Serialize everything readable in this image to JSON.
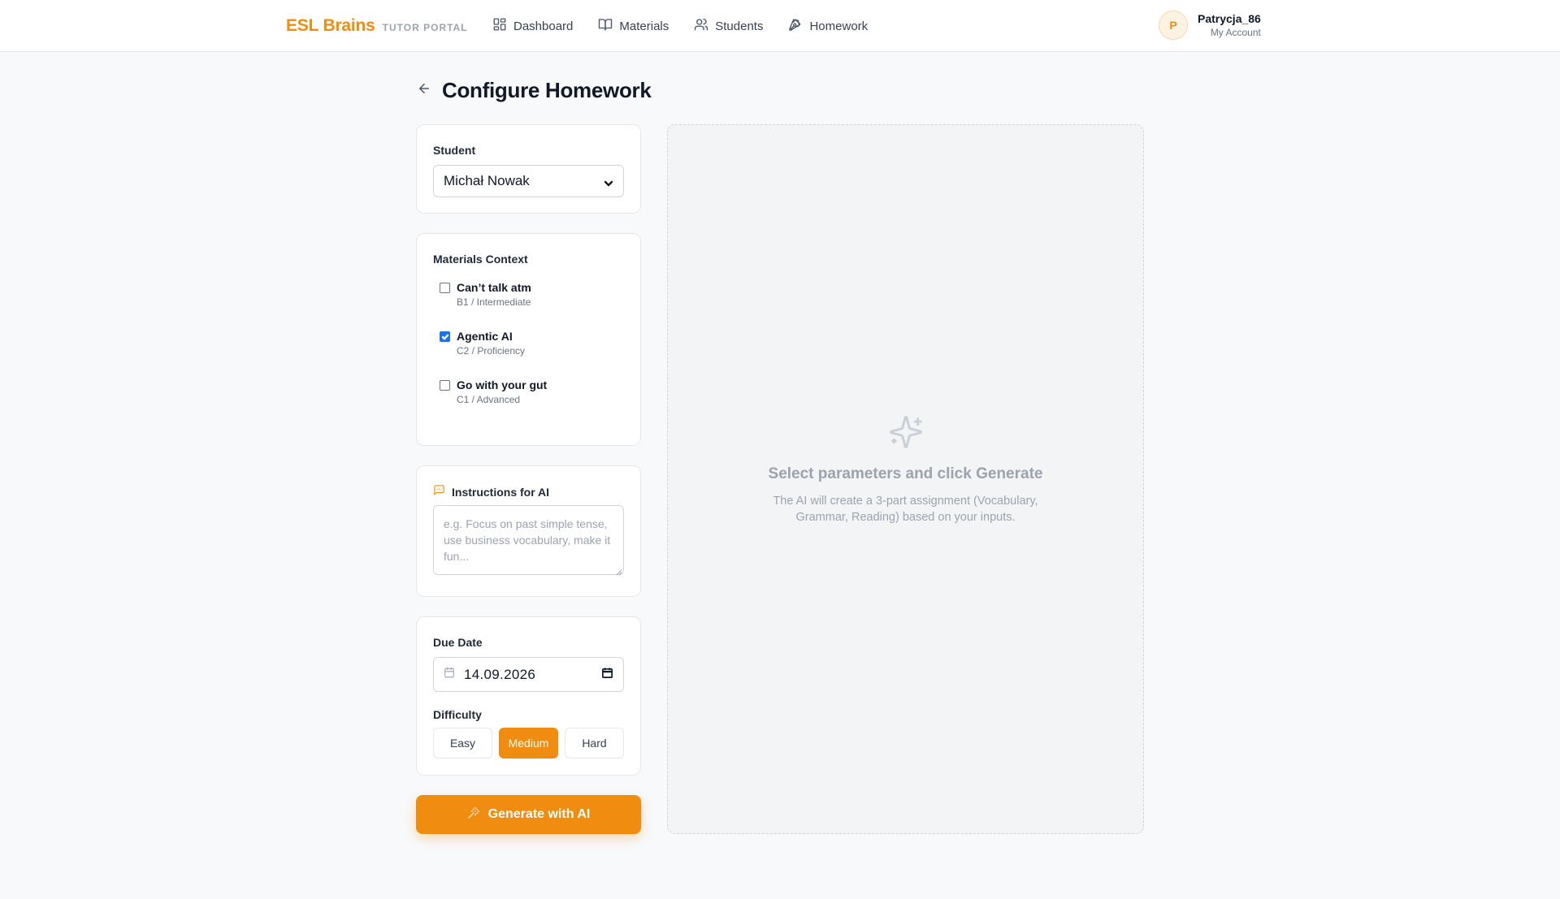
{
  "brand": {
    "name": "ESL Brains",
    "subtitle": "TUTOR PORTAL",
    "color": "#f08c0f"
  },
  "nav": {
    "items": [
      {
        "label": "Dashboard",
        "icon": "dashboard-icon"
      },
      {
        "label": "Materials",
        "icon": "book-icon"
      },
      {
        "label": "Students",
        "icon": "users-icon"
      },
      {
        "label": "Homework",
        "icon": "pen-icon"
      }
    ]
  },
  "account": {
    "initial": "P",
    "name": "Patrycja_86",
    "subtitle": "My Account"
  },
  "page": {
    "title": "Configure Homework",
    "back_icon": "arrow-left-icon"
  },
  "student": {
    "label": "Student",
    "selected": "Michał Nowak"
  },
  "materials": {
    "label": "Materials Context",
    "items": [
      {
        "title": "Can’t talk atm",
        "level": "B1 / Intermediate",
        "checked": false
      },
      {
        "title": "Agentic AI",
        "level": "C2 / Proficiency",
        "checked": true
      },
      {
        "title": "Go with your gut",
        "level": "C1 / Advanced",
        "checked": false
      }
    ]
  },
  "instructions": {
    "label": "Instructions for AI",
    "icon": "message-square-icon",
    "value": "",
    "placeholder": "e.g. Focus on past simple tense, use business vocabulary, make it fun..."
  },
  "due": {
    "label": "Due Date",
    "value": "14.09.2026",
    "icon": "calendar-icon"
  },
  "difficulty": {
    "label": "Difficulty",
    "options": [
      "Easy",
      "Medium",
      "Hard"
    ],
    "selected": "Medium"
  },
  "generate": {
    "label": "Generate with AI",
    "icon": "wand-sparkles-icon"
  },
  "preview": {
    "icon": "sparkles-icon",
    "title": "Select parameters and click Generate",
    "description": "The AI will create a 3-part assignment (Vocabulary, Grammar, Reading) based on your inputs."
  }
}
